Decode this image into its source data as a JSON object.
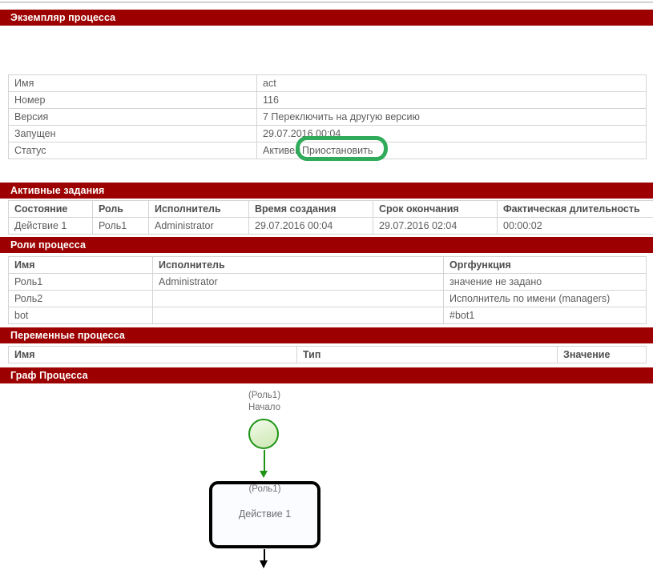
{
  "sections": {
    "instance": "Экземпляр процесса",
    "active_tasks": "Активные задания",
    "process_roles": "Роли процесса",
    "process_variables": "Переменные процесса",
    "process_graph": "Граф Процесса"
  },
  "instance_table": {
    "rows": [
      {
        "label": "Имя",
        "value": "act"
      },
      {
        "label": "Номер",
        "value": "116"
      },
      {
        "label": "Версия",
        "value": "7 Переключить на другую версию"
      },
      {
        "label": "Запущен",
        "value": "29.07.2016 00:04"
      }
    ],
    "status_label": "Статус",
    "status_value": "Активен",
    "status_action": "Приостановить"
  },
  "active_tasks_table": {
    "headers": [
      "Состояние",
      "Роль",
      "Исполнитель",
      "Время создания",
      "Срок окончания",
      "Фактическая длительность"
    ],
    "rows": [
      [
        "Действие 1",
        "Роль1",
        "Administrator",
        "29.07.2016 00:04",
        "29.07.2016 02:04",
        "00:00:02"
      ]
    ]
  },
  "process_roles_table": {
    "headers": [
      "Имя",
      "Исполнитель",
      "Оргфункция"
    ],
    "rows": [
      [
        "Роль1",
        "Administrator",
        "значение не задано"
      ],
      [
        "Роль2",
        "",
        "Исполнитель по имени (managers)"
      ],
      [
        "bot",
        "",
        "#bot1"
      ]
    ]
  },
  "process_variables_table": {
    "headers": [
      "Имя",
      "Тип",
      "Значение"
    ],
    "rows": []
  },
  "graph": {
    "start_role": "(Роль1)",
    "start_name": "Начало",
    "task_role": "(Роль1)",
    "task_name": "Действие 1"
  },
  "colors": {
    "header_red": "#9c0000",
    "annotation_green": "#2fab5a",
    "start_node_green": "#1e9415",
    "text_gray": "#5d5d5d"
  }
}
